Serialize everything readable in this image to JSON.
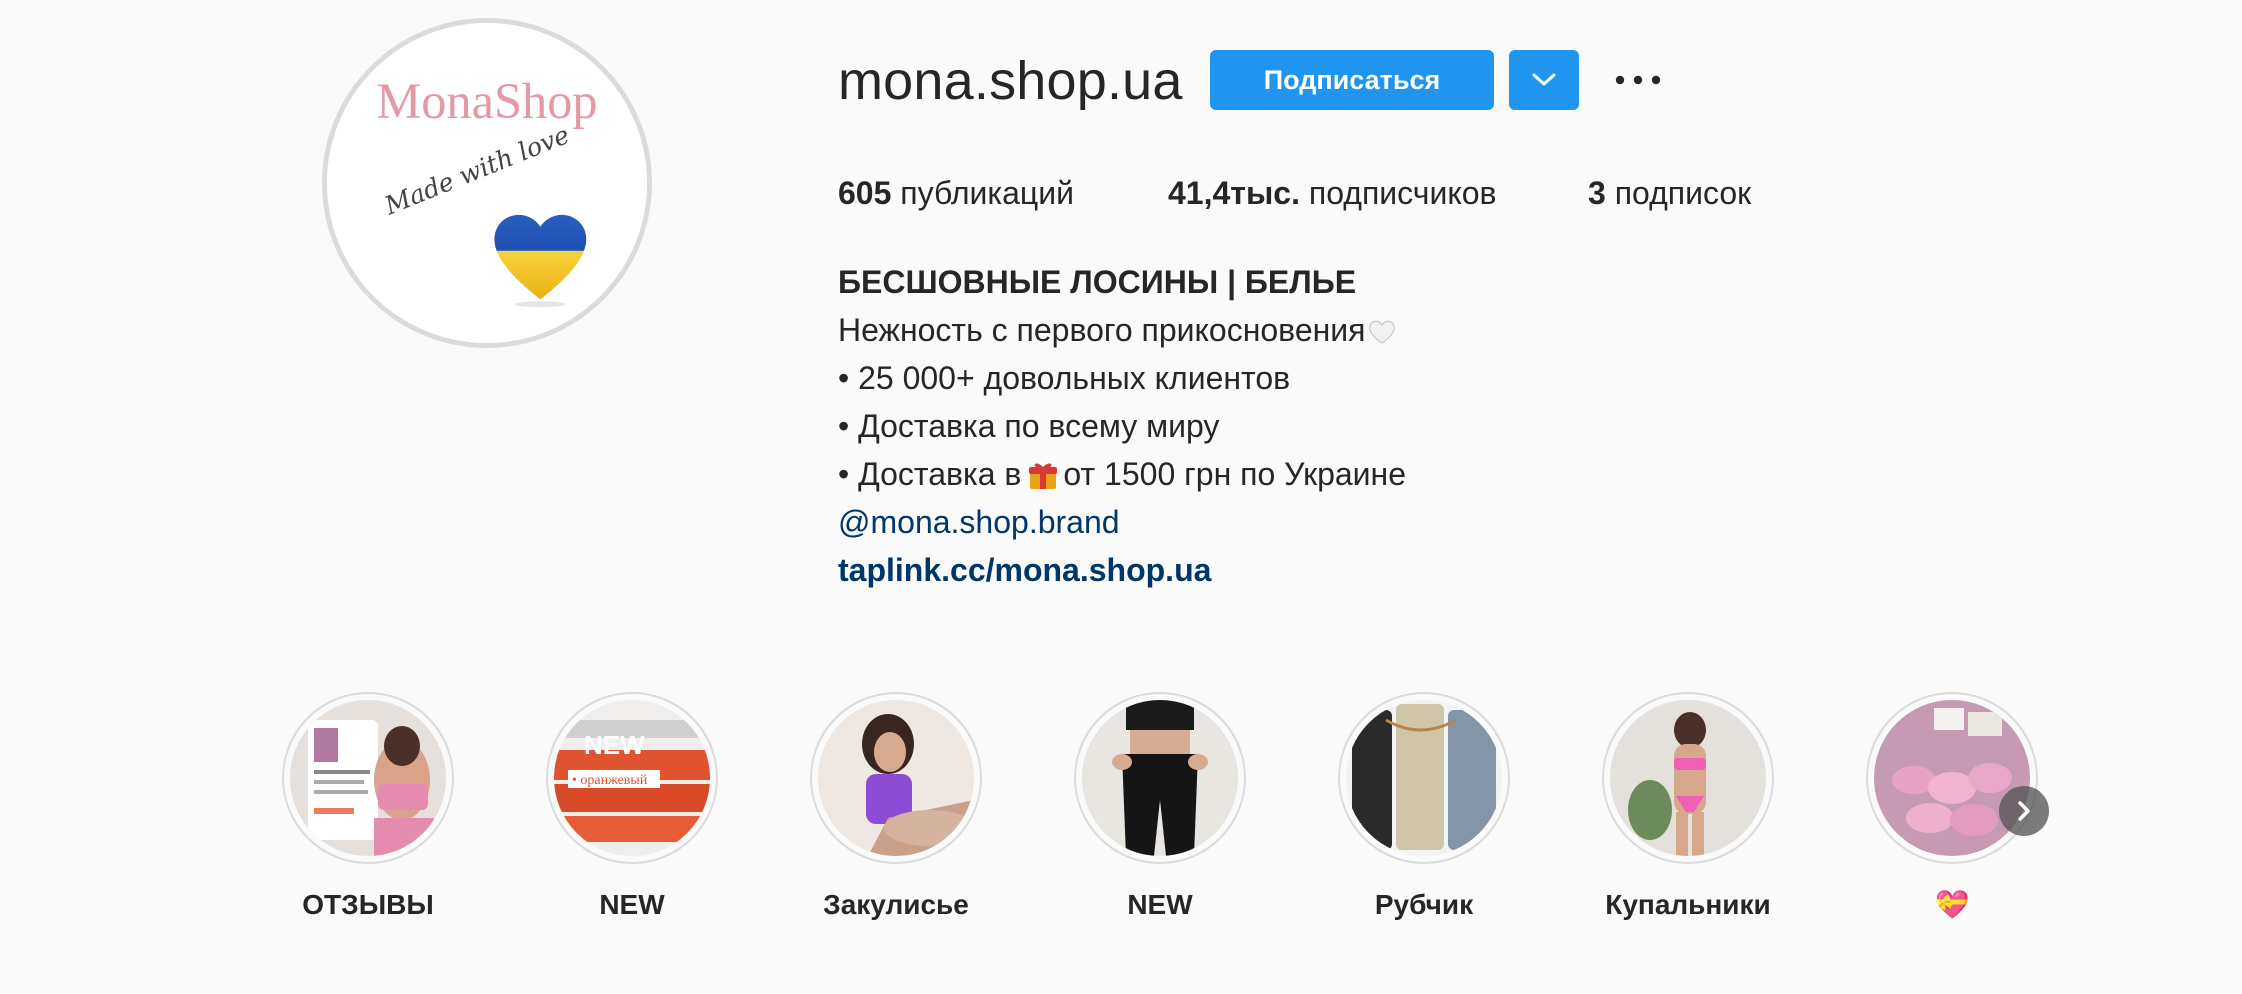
{
  "profile": {
    "username": "mona.shop.ua",
    "avatar_logo_text": "MonaShop",
    "avatar_script_text": "Made with love",
    "follow_label": "Подписаться",
    "dropdown_icon": "chevron-down-icon",
    "more_icon": "more-horizontal-icon"
  },
  "stats": {
    "posts_count": "605",
    "posts_label": "публикаций",
    "followers_count": "41,4тыс.",
    "followers_label": "подписчиков",
    "following_count": "3",
    "following_label": "подписок"
  },
  "bio": {
    "name": "БЕСШОВНЫЕ ЛОСИНЫ | БЕЛЬЕ",
    "line1": "Нежность с первого прикосновения",
    "line2": "• 25 000+ довольных клиентов",
    "line3": "• Доставка по всему миру",
    "line4_before": "• Доставка в",
    "line4_after": "от 1500 грн по Украине",
    "mention": "@mona.shop.brand",
    "link": "taplink.cc/mona.shop.ua"
  },
  "highlights": [
    {
      "label": "ОТЗЫВЫ"
    },
    {
      "label": "NEW",
      "overlay_text": "NEW",
      "overlay_caption": "• оранжевый"
    },
    {
      "label": "Закулисье"
    },
    {
      "label": "NEW"
    },
    {
      "label": "Рубчик"
    },
    {
      "label": "Купальники"
    },
    {
      "label": "💝"
    }
  ],
  "colors": {
    "accent": "#1f95f0",
    "link": "#00376b",
    "text": "#262626",
    "background": "#fafafa",
    "brand_pink": "#e49aa6"
  }
}
